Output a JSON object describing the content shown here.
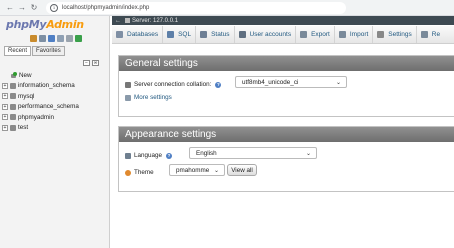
{
  "browser": {
    "url": "localhost/phpmyadmin/index.php",
    "back_glyph": "←",
    "forward_glyph": "→",
    "reload_glyph": "↻",
    "info_glyph": "i"
  },
  "sidebar": {
    "logo_php": "php",
    "logo_my": "My",
    "logo_admin": "Admin",
    "tabs": [
      "Recent",
      "Favorites"
    ],
    "tree_collapse_glyph": "−",
    "tree_link_glyph": "∞",
    "expander_glyph": "+",
    "items": [
      {
        "label": "New"
      },
      {
        "label": "information_schema"
      },
      {
        "label": "mysql"
      },
      {
        "label": "performance_schema"
      },
      {
        "label": "phpmyadmin"
      },
      {
        "label": "test"
      }
    ]
  },
  "server_bar": {
    "back_glyph": "←",
    "text": "Server: 127.0.0.1"
  },
  "top_menu": {
    "items": [
      {
        "label": "Databases",
        "icon": "database-icon",
        "color": "#7f8fa4"
      },
      {
        "label": "SQL",
        "icon": "sql-icon",
        "color": "#5d7fa8"
      },
      {
        "label": "Status",
        "icon": "status-icon",
        "color": "#6e7f95"
      },
      {
        "label": "User accounts",
        "icon": "users-icon",
        "color": "#5f6f80"
      },
      {
        "label": "Export",
        "icon": "export-icon",
        "color": "#7a8a9a"
      },
      {
        "label": "Import",
        "icon": "import-icon",
        "color": "#7a8a9a"
      },
      {
        "label": "Settings",
        "icon": "wrench-icon",
        "color": "#888"
      },
      {
        "label": "Re",
        "icon": "replication-icon",
        "color": "#7a8a9a"
      }
    ]
  },
  "general_settings": {
    "title": "General settings",
    "collation_label": "Server connection collation:",
    "collation_value": "utf8mb4_unicode_ci",
    "more_settings": "More settings",
    "help_glyph": "?"
  },
  "appearance_settings": {
    "title": "Appearance settings",
    "language_label": "Language",
    "language_value": "English",
    "theme_label": "Theme",
    "theme_value": "pmahomme",
    "view_all": "View all",
    "help_glyph": "?",
    "caret_glyph": "⌄"
  },
  "colors": {
    "accent_blue": "#235a81",
    "panel_header": "#777777",
    "logo_blue": "#6c78af",
    "logo_orange": "#f89c0e",
    "server_bar": "#3e4a52"
  }
}
